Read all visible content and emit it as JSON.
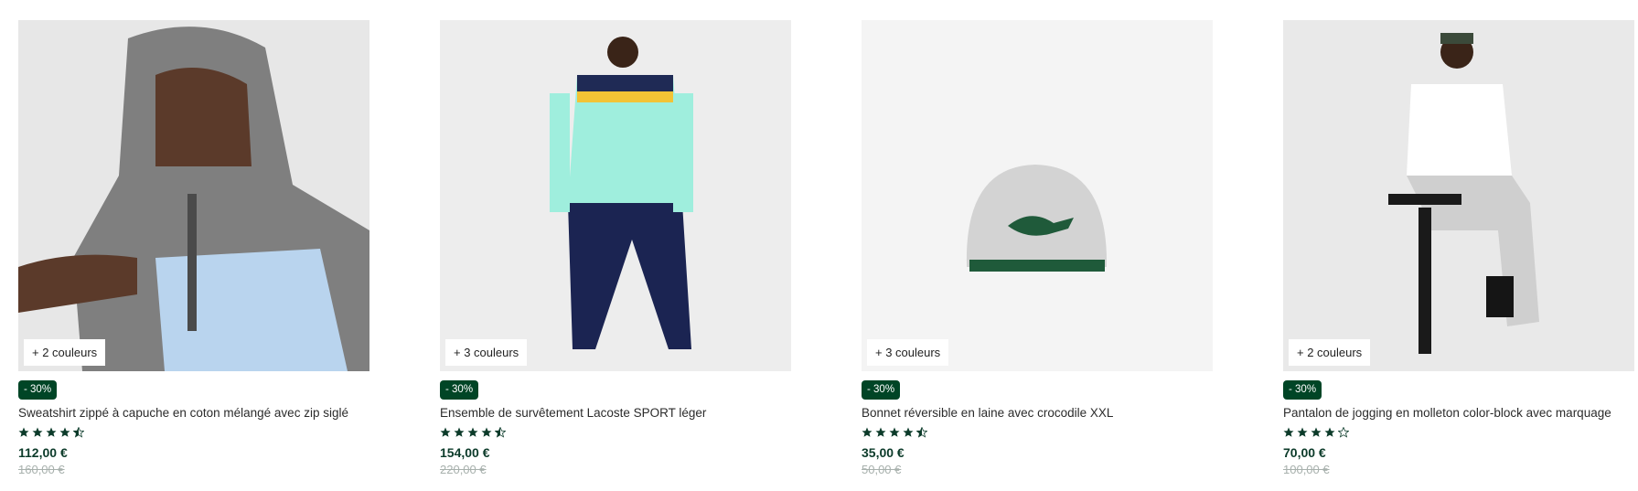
{
  "products": [
    {
      "colors_label": "+ 2 couleurs",
      "badge": "- 30%",
      "title": "Sweatshirt zippé à capuche en coton mélangé avec zip siglé",
      "price": "112,00 €",
      "old_price": "160,00 €",
      "rating": 4.5
    },
    {
      "colors_label": "+ 3 couleurs",
      "badge": "- 30%",
      "title": "Ensemble de survêtement Lacoste SPORT léger",
      "price": "154,00 €",
      "old_price": "220,00 €",
      "rating": 4.5
    },
    {
      "colors_label": "+ 3 couleurs",
      "badge": "- 30%",
      "title": "Bonnet réversible en laine avec crocodile XXL",
      "price": "35,00 €",
      "old_price": "50,00 €",
      "rating": 4.5
    },
    {
      "colors_label": "+ 2 couleurs",
      "badge": "- 30%",
      "title": "Pantalon de jogging en molleton color-block avec marquage",
      "price": "70,00 €",
      "old_price": "100,00 €",
      "rating": 4
    }
  ],
  "colors": {
    "brand_green": "#004526",
    "price_green": "#0c3b2a",
    "strike_grey": "#a8b1ad"
  }
}
